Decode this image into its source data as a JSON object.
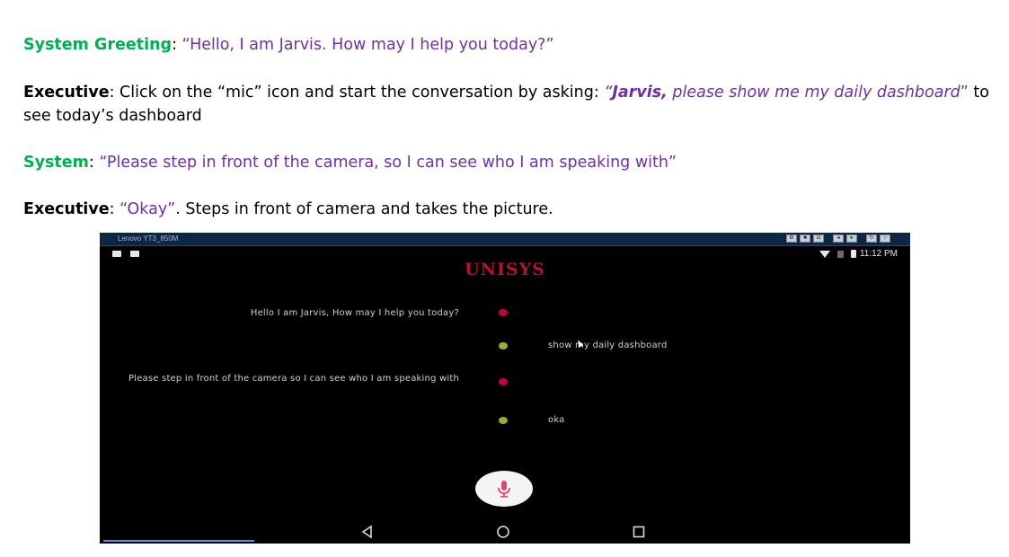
{
  "dialogue": {
    "line1": {
      "speaker": "System Greeting",
      "sep": ": ",
      "quote": "“Hello, I am Jarvis. How may I help you today?”"
    },
    "line2": {
      "speaker": "Executive",
      "text_before": ": Click on the “mic” icon and start the conversation by asking:  ",
      "quote_open": "“",
      "quote_bold": "Jarvis,",
      "quote_rest": " please show me my daily dashboard",
      "quote_close": "”",
      "text_after": " to see today’s dashboard"
    },
    "line3": {
      "speaker": "System",
      "sep": ": ",
      "quote": "“Please step in front of the camera, so I can see who I am speaking with”"
    },
    "line4": {
      "speaker": "Executive",
      "sep": ": ",
      "quote": "“Okay”",
      "text_after": ". Steps in front of camera and takes the picture."
    }
  },
  "phone": {
    "device_name": "Lenovo YT3_850M",
    "time": "11:12 PM",
    "brand": "UNISYS",
    "chat": [
      {
        "role": "system",
        "text": "Hello I am Jarvis, How may I help you today?"
      },
      {
        "role": "user",
        "text": "show my daily dashboard"
      },
      {
        "role": "system",
        "text": "Please step in front of the camera so I can see who I am speaking with"
      },
      {
        "role": "user",
        "text": "oka"
      }
    ],
    "colors": {
      "system_dot": "#c8003c",
      "user_dot": "#9ab020",
      "brand": "#b3103a",
      "mic": "#e0457a"
    },
    "icons": {
      "mic": "mic-icon",
      "back": "back-triangle-icon",
      "home": "home-circle-icon",
      "recent": "recent-apps-square-icon"
    }
  }
}
